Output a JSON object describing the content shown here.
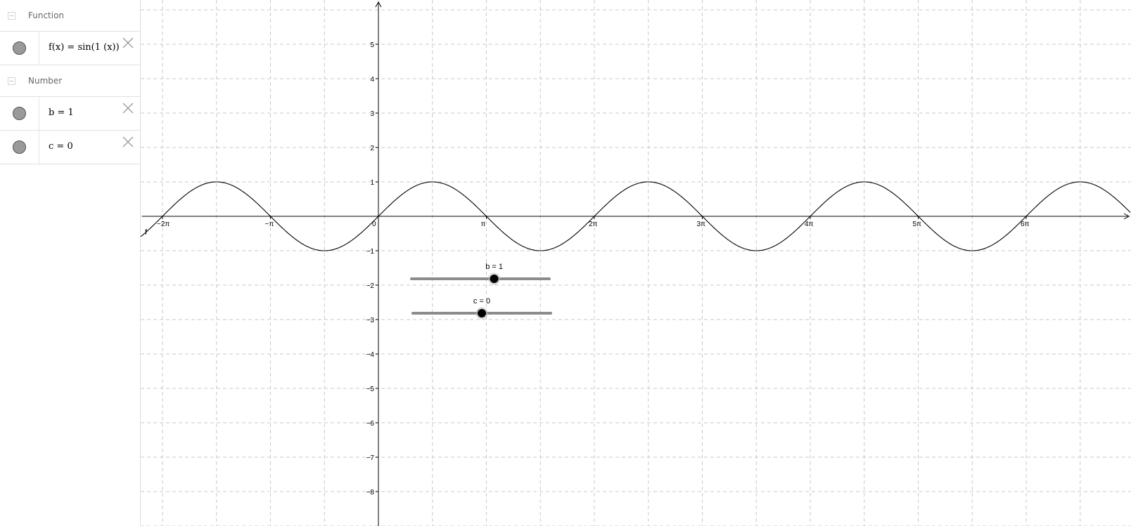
{
  "algebra": {
    "groups": [
      {
        "label": "Function",
        "items": [
          {
            "text": "f(x) = sin(1 (x))"
          }
        ]
      },
      {
        "label": "Number",
        "items": [
          {
            "text": "b = 1"
          },
          {
            "text": "c = 0"
          }
        ]
      }
    ]
  },
  "graph": {
    "function_label": "f",
    "x_ticks": [
      "−2π",
      "−π",
      "0",
      "π",
      "2π",
      "3π",
      "4π",
      "5π",
      "6π"
    ],
    "y_ticks": [
      "5",
      "4",
      "3",
      "2",
      "1",
      "−1",
      "−2",
      "−3",
      "−4",
      "−5",
      "−6",
      "−7",
      "−8"
    ],
    "sliders": {
      "b": {
        "label": "b = 1",
        "value": 1,
        "min": -5,
        "max": 5
      },
      "c": {
        "label": "c = 0",
        "value": 0,
        "min": -5,
        "max": 5
      }
    }
  }
}
